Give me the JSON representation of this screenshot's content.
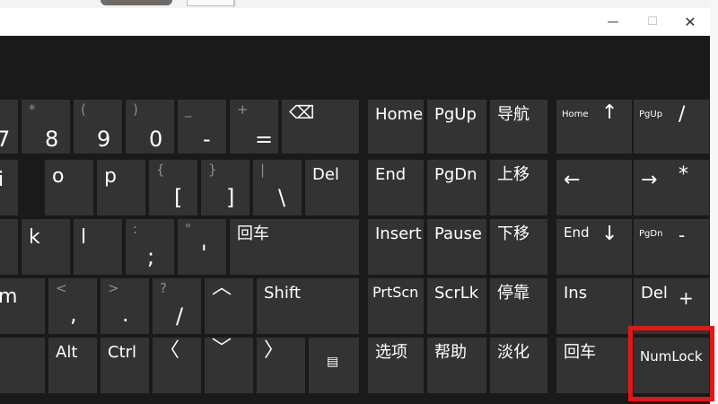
{
  "window": {
    "minimize_glyph": "—",
    "maximize_glyph": "☐",
    "close_glyph": "✕"
  },
  "keys": {
    "seven": "7",
    "eight": "8",
    "eight_shift": "*",
    "nine": "9",
    "nine_shift": "(",
    "zero": "0",
    "zero_shift": ")",
    "minus": "-",
    "minus_shift": "_",
    "equals": "=",
    "equals_shift": "+",
    "backspace_icon": "⌫",
    "home": "Home",
    "pgup": "PgUp",
    "nav": "导航",
    "num_home": "Home",
    "num_up": "↑",
    "num_pgup": "PgUp",
    "num_slash": "/",
    "i": "i",
    "o": "o",
    "p": "p",
    "lbracket": "[",
    "lbracket_shift": "{",
    "rbracket": "]",
    "rbracket_shift": "}",
    "backslash": "\\",
    "backslash_shift": "|",
    "del": "Del",
    "end": "End",
    "pgdn": "PgDn",
    "move_up": "上移",
    "num_left": "←",
    "num_right": "→",
    "num_star": "*",
    "k": "k",
    "l": "l",
    "semicolon": ";",
    "semicolon_shift": ":",
    "quote": "'",
    "quote_shift": "\"",
    "enter": "回车",
    "insert": "Insert",
    "pause": "Pause",
    "move_down": "下移",
    "num_end": "End",
    "num_down": "↓",
    "num_pgdn": "PgDn",
    "num_minus": "-",
    "m": "m",
    "comma": ",",
    "comma_shift": "<",
    "period": ".",
    "period_shift": ">",
    "slash": "/",
    "slash_shift": "?",
    "up": "︿",
    "shift": "Shift",
    "prtscn": "PrtScn",
    "scrlk": "ScrLk",
    "dock": "停靠",
    "num_ins": "Ins",
    "num_del": "Del",
    "num_plus": "+",
    "alt": "Alt",
    "ctrl": "Ctrl",
    "left": "〈",
    "down": "﹀",
    "right": "〉",
    "menu_icon": "▤",
    "options": "选项",
    "help": "帮助",
    "fade": "淡化",
    "num_enter": "回车",
    "numlock": "NumLock"
  }
}
